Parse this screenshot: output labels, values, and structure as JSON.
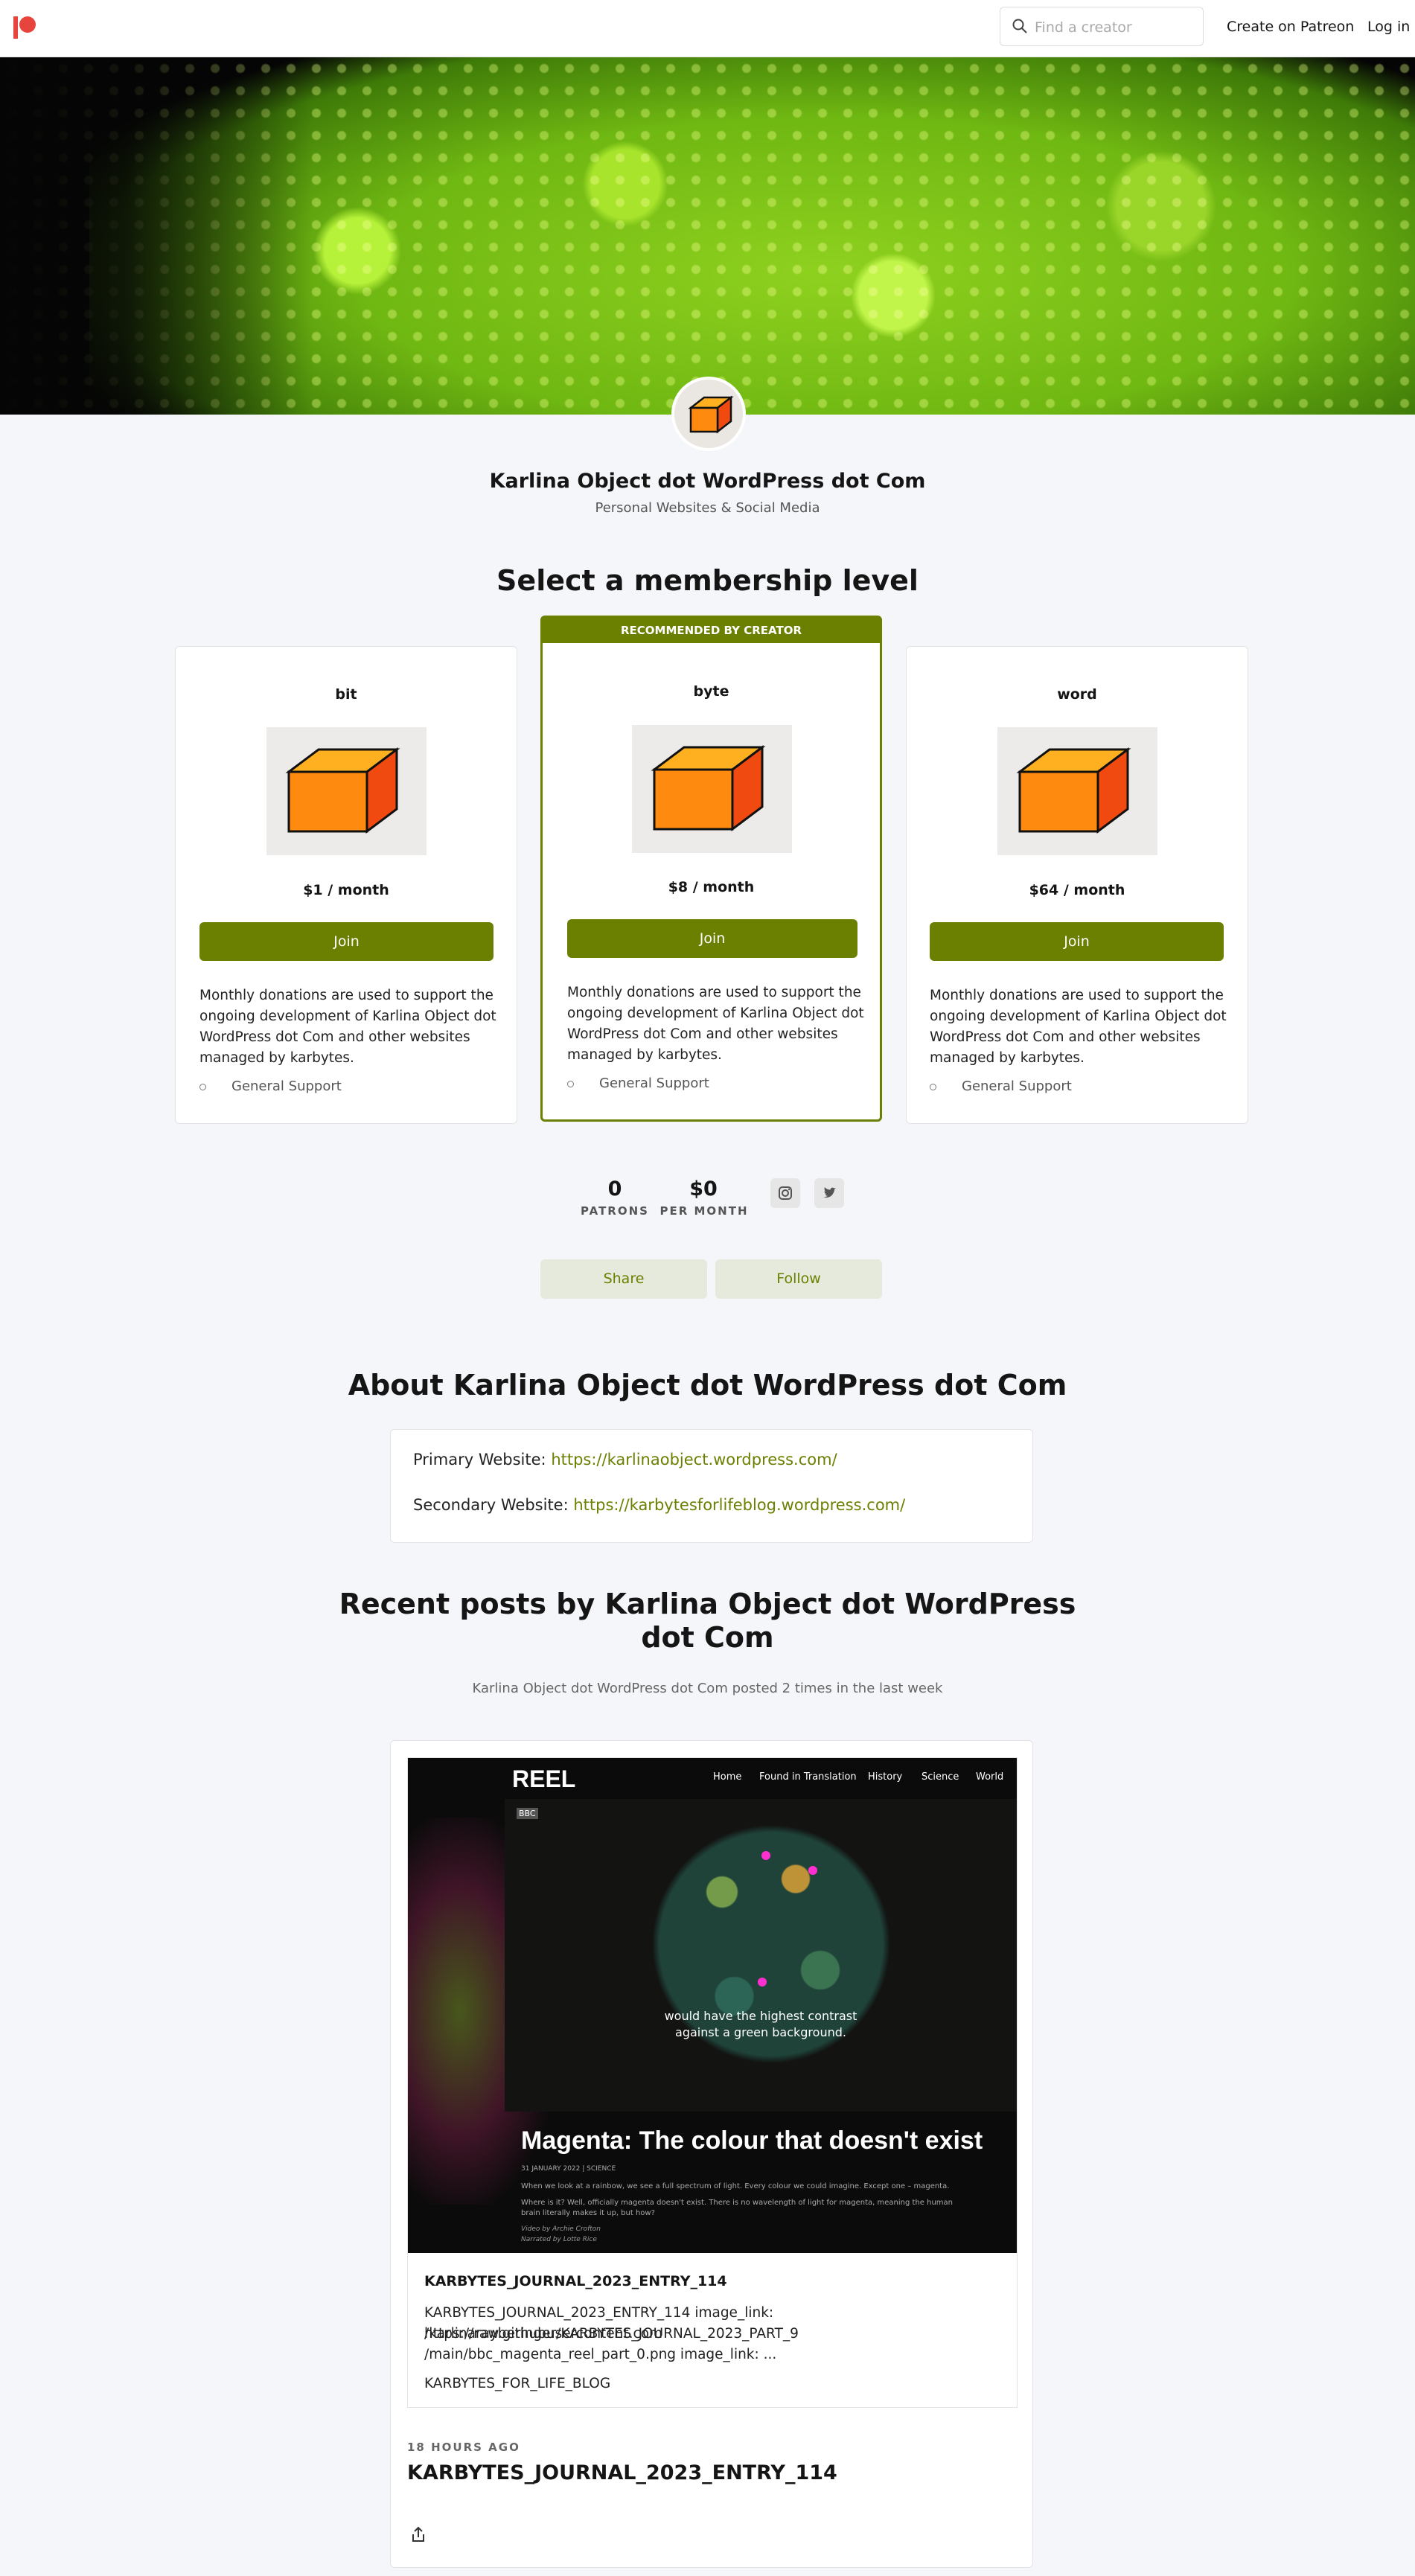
{
  "nav": {
    "search_placeholder": "Find a creator",
    "create_label": "Create on Patreon",
    "login_label": "Log in"
  },
  "creator": {
    "name": "Karlina Object dot WordPress dot Com",
    "category": "Personal Websites & Social Media"
  },
  "membership": {
    "title": "Select a membership level",
    "recommended_label": "RECOMMENDED BY CREATOR",
    "tiers": [
      {
        "name": "bit",
        "price": "$1 / month",
        "join_label": "Join",
        "description": "Monthly donations are used to support the ongoing development of Karlina Object dot WordPress dot Com and other websites managed by karbytes.",
        "benefit": "General Support"
      },
      {
        "name": "byte",
        "price": "$8 / month",
        "join_label": "Join",
        "description": "Monthly donations are used to support the ongoing development of Karlina Object dot WordPress dot Com and other websites managed by karbytes.",
        "benefit": "General Support"
      },
      {
        "name": "word",
        "price": "$64 / month",
        "join_label": "Join",
        "description": "Monthly donations are used to support the ongoing development of Karlina Object dot WordPress dot Com and other websites managed by karbytes.",
        "benefit": "General Support"
      }
    ]
  },
  "stats": {
    "patrons_value": "0",
    "patrons_label": "PATRONS",
    "per_month_value": "$0",
    "per_month_label": "PER MONTH",
    "social_icons": [
      "instagram-icon",
      "twitter-icon"
    ]
  },
  "actions": {
    "share_label": "Share",
    "follow_label": "Follow"
  },
  "about": {
    "title": "About Karlina Object dot WordPress dot Com",
    "primary_label": "Primary Website:",
    "primary_url": "https://karlinaobject.wordpress.com/",
    "secondary_label": "Secondary Website:",
    "secondary_url": "https://karbytesforlifeblog.wordpress.com/"
  },
  "recent": {
    "title_line1": "Recent posts by Karlina Object dot WordPress",
    "title_line2": "dot Com",
    "posted_info": "Karlina Object dot WordPress dot Com posted 2 times in the last week",
    "post": {
      "embed": {
        "site_name": "REEL",
        "nav": [
          "Home",
          "Found in Translation",
          "History",
          "Science",
          "World"
        ],
        "brand": "BBC",
        "caption_line1": "would have the highest contrast",
        "caption_line2": "against a green background.",
        "headline": "Magenta: The colour that doesn't exist",
        "meta": "31 JANUARY 2022 | SCIENCE",
        "para1": "When we look at a rainbow, we see a full spectrum of light. Every colour we could imagine. Except one – magenta.",
        "para2_line1": "Where is it? Well, officially magenta doesn't exist. There is no wavelength of light for magenta, meaning the human",
        "para2_line2": "brain literally makes it up, but how?",
        "credit1": "Video by Archie Crofton",
        "credit2": "Narrated by Lotte Rice"
      },
      "embed_title": "KARBYTES_JOURNAL_2023_ENTRY_114",
      "embed_text_line1": "KARBYTES_JOURNAL_2023_ENTRY_114 image_link: https://raw.githubusercontent.com",
      "embed_text_line2": "/karlinarayberinger/KARBYTES_JOURNAL_2023_PART_9",
      "embed_text_line3": "/main/bbc_magenta_reel_part_0.png image_link: ...",
      "embed_footer": "KARBYTES_FOR_LIFE_BLOG",
      "time": "18 HOURS AGO",
      "title": "KARBYTES_JOURNAL_2023_ENTRY_114"
    }
  },
  "colors": {
    "accent": "#6b7f00",
    "brand": "#e8443e",
    "background": "#f5f6fa"
  }
}
